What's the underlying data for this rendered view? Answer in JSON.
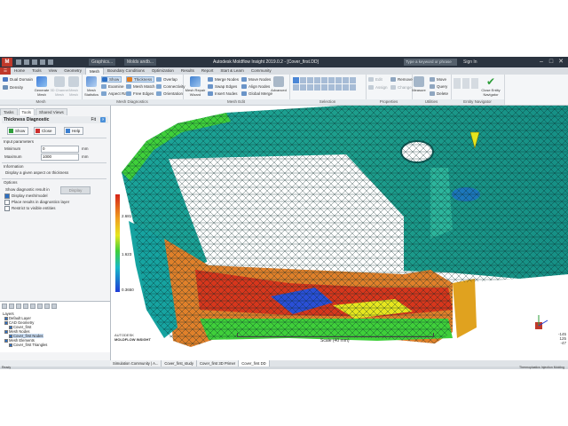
{
  "window": {
    "logo": "M",
    "title": "Autodesk Moldflow Insight 2019.0.2 - [Cover_first.DD]",
    "top_tabs": [
      "Graphics...",
      "Molds andb..."
    ],
    "search_placeholder": "Type a keyword or phrase",
    "sign_in": "Sign In",
    "min": "–",
    "max": "□",
    "close": "✕"
  },
  "ribbon_tabs": [
    "Home",
    "Tools",
    "View",
    "Geometry",
    "Mesh",
    "Boundary Conditions",
    "Optimization",
    "Results",
    "Report",
    "Start & Learn",
    "Community"
  ],
  "active_ribbon_tab": "Mesh",
  "ribbon": {
    "mesh": {
      "label": "Mesh",
      "dual_domain": "Dual Domain",
      "density": "Density",
      "generate_mesh": "Generate Mesh",
      "channel_mesh": "3D Channel Mesh",
      "mesh_mesh": "Mesh Mesh",
      "group_label": "Mesh"
    },
    "diagnostics": {
      "label": "Mesh Diagnostics",
      "statistics": "Mesh Statistics",
      "show": "Show",
      "thickness": "Thickness",
      "overlap": "Overlap",
      "examine": "Examine",
      "mesh_match": "Mesh Match",
      "connectivity": "Connectivity",
      "aspect_ratio": "Aspect Ratio",
      "free_edges": "Free Edges",
      "orientation": "Orientation"
    },
    "edit": {
      "label": "Mesh Edit",
      "repair_wizard": "Mesh Repair Wizard",
      "merge_nodes": "Merge Nodes",
      "move_nodes": "Move Nodes",
      "swap_edges": "Swap Edges",
      "align_nodes": "Align Nodes",
      "insert_nodes": "Insert Nodes",
      "global_merge": "Global Merge",
      "advanced": "Advanced"
    },
    "selection": {
      "label": "Selection"
    },
    "properties": {
      "label": "Properties",
      "edit": "Edit",
      "assign": "Assign",
      "remove": "Remove",
      "change": "Change"
    },
    "utilities": {
      "label": "Utilities",
      "measure": "Measure",
      "move": "Move",
      "query": "Query",
      "delete": "Delete"
    },
    "navigator": {
      "label": "Entity Navigator",
      "close": "Close Entity Navigator"
    }
  },
  "left_panel": {
    "tabs": [
      "Tasks",
      "Tools",
      "Shared Views"
    ],
    "active_tab": "Tools",
    "title": "Thickness Diagnostic",
    "fit": "Fit",
    "help_glyph": "?",
    "show": "Show",
    "close": "Close",
    "help": "Help",
    "input_parameters": "Input parameters",
    "minimum_label": "Minimum",
    "minimum_value": "0",
    "maximum_label": "Maximum",
    "maximum_value": "1000",
    "unit": "mm",
    "information_label": "Information",
    "information_text": "Display a given aspect on thickness",
    "options_label": "Options",
    "show_result_in": "Show diagnostic result in",
    "display_option": "Display",
    "opt_display_mesh": "Display mesh/model",
    "opt_place_layer": "Place results in diagnostics layer",
    "opt_restrict": "Restrict to visible entities"
  },
  "layers": {
    "title": "Layers",
    "items": [
      {
        "label": "Default Layer",
        "checked": true,
        "indent": 1,
        "selected": false
      },
      {
        "label": "CAD Geometry",
        "checked": true,
        "indent": 1,
        "selected": false
      },
      {
        "label": "Cover_first",
        "checked": true,
        "indent": 2,
        "selected": false
      },
      {
        "label": "Mesh Nodes",
        "checked": true,
        "indent": 1,
        "selected": false
      },
      {
        "label": "Cover_first Nodes",
        "checked": true,
        "indent": 2,
        "selected": true
      },
      {
        "label": "Mesh Elements",
        "checked": true,
        "indent": 1,
        "selected": false
      },
      {
        "label": "Cover_first Triangles",
        "checked": true,
        "indent": 2,
        "selected": false
      }
    ]
  },
  "viewport": {
    "legend_max": "2.681",
    "legend_mid": "1.623",
    "legend_min": "0.3650",
    "brand_line1": "AUTODESK",
    "brand_line2": "MOLDFLOW INSIGHT",
    "scale_label": "Scale (40 mm)",
    "coords": [
      "-145",
      "125",
      "-47"
    ]
  },
  "doc_tabs": [
    {
      "label": "Simulation Community | A...",
      "active": false
    },
    {
      "label": "Cover_first_study",
      "active": false
    },
    {
      "label": "Cover_first 3D Primer",
      "active": false
    },
    {
      "label": "Cover_first DD",
      "active": true
    }
  ],
  "status": {
    "left": "Ready",
    "right": "Thermoplastics Injection Molding"
  }
}
